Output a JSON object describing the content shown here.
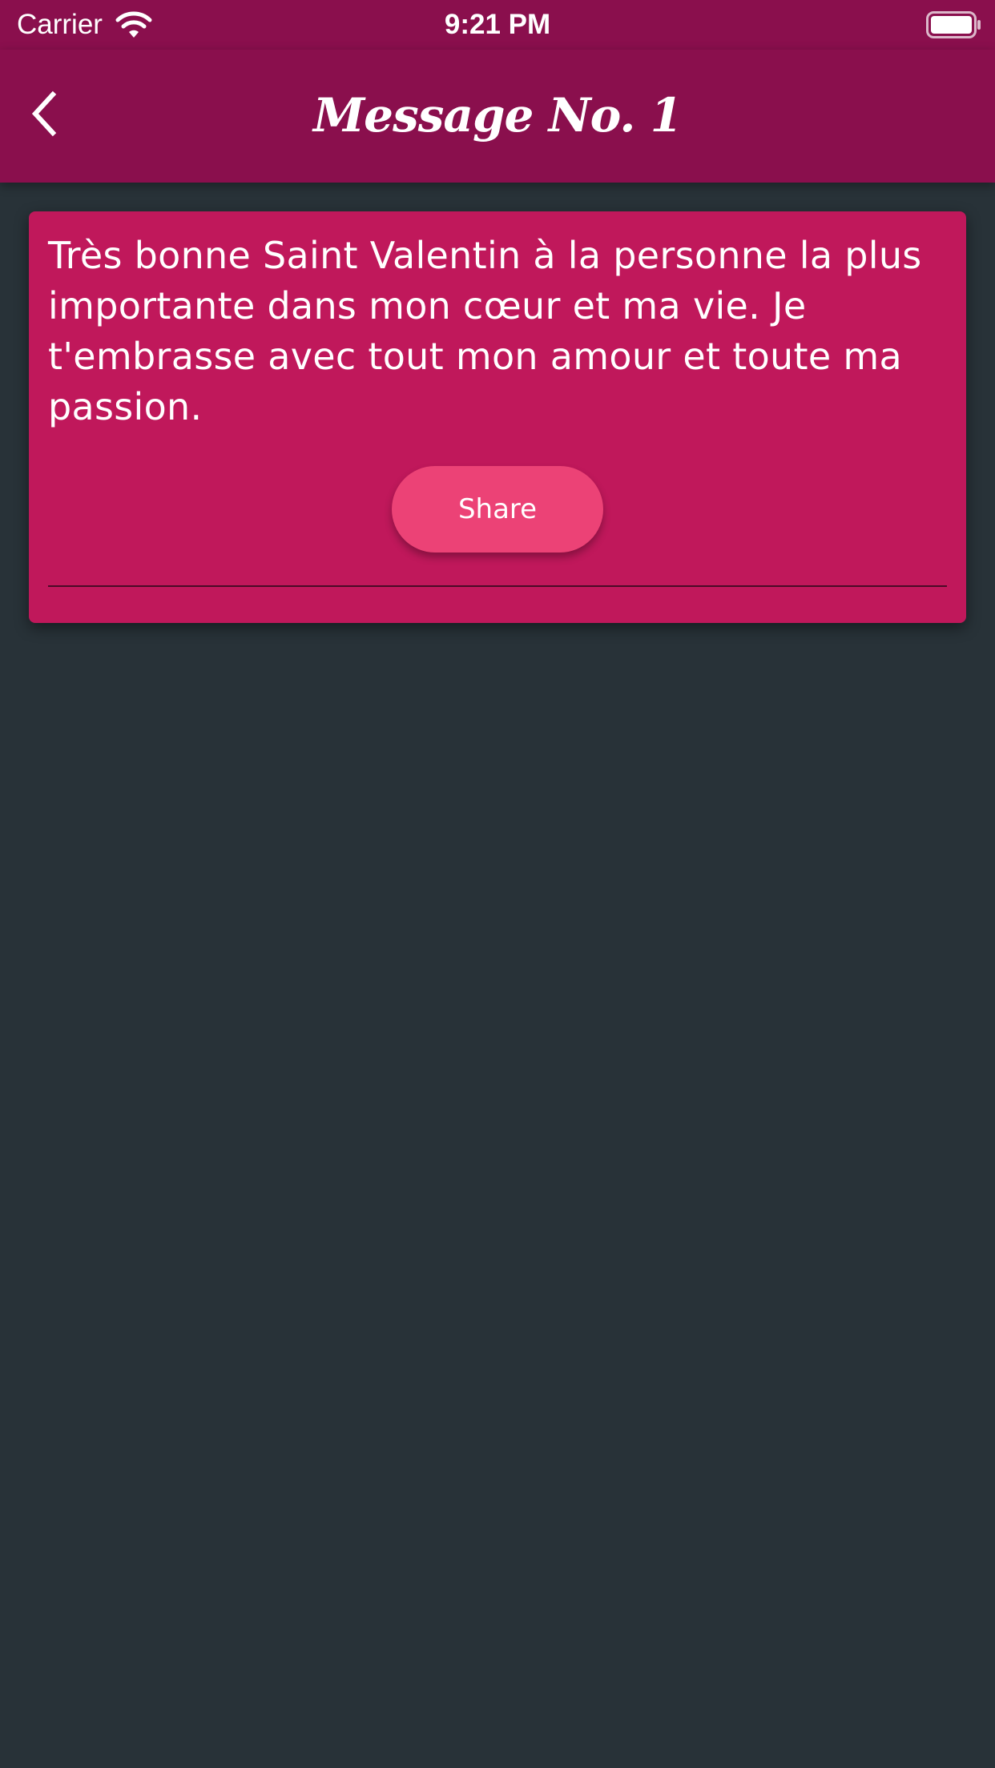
{
  "status_bar": {
    "carrier": "Carrier",
    "time": "9:21 PM",
    "wifi_icon": "wifi-icon",
    "battery_icon": "battery-icon"
  },
  "nav_bar": {
    "title": "Message No. 1",
    "back_icon": "chevron-left-icon"
  },
  "message": {
    "text": "Très bonne Saint Valentin à la personne la plus importante dans mon cœur et ma vie. Je t'embrasse avec tout mon amour et toute ma passion.",
    "share_label": "Share"
  },
  "colors": {
    "nav_background": "#8a0f4d",
    "card_background": "#c0185b",
    "share_button": "#ec4276",
    "page_background": "#283238"
  }
}
